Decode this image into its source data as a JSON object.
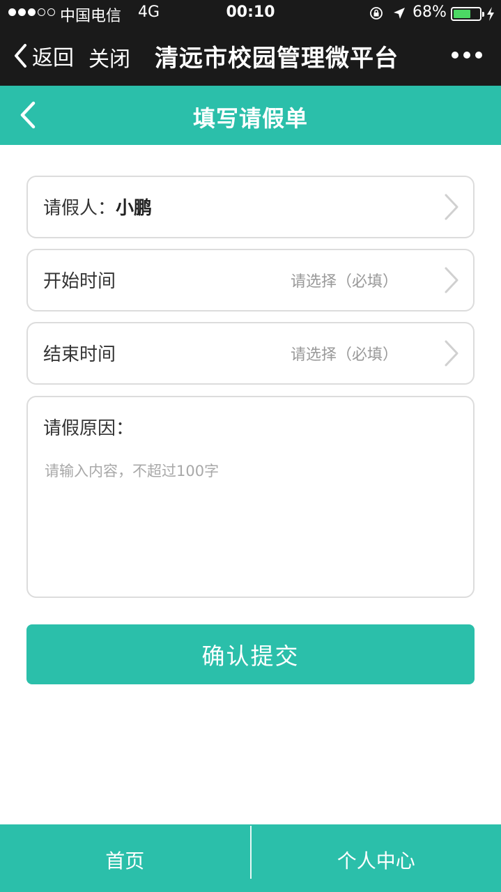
{
  "status_bar": {
    "signal_bars_on": 3,
    "carrier": "中国电信",
    "network": "4G",
    "time": "00:10",
    "battery_percent": "68%",
    "icons": [
      "orientation-lock-icon",
      "location-arrow-icon",
      "battery-icon",
      "charging-bolt-icon"
    ]
  },
  "wechat_nav": {
    "back_label": "返回",
    "close_label": "关闭",
    "title": "清远市校园管理微平台",
    "more_icon": "more-dots-icon"
  },
  "page_header": {
    "back_icon": "chevron-left-icon",
    "title": "填写请假单"
  },
  "form": {
    "applicant": {
      "label": "请假人：",
      "value": "小鹏"
    },
    "start_time": {
      "label": "开始时间",
      "placeholder": "请选择（必填）"
    },
    "end_time": {
      "label": "结束时间",
      "placeholder": "请选择（必填）"
    },
    "reason": {
      "label": "请假原因：",
      "placeholder": "请输入内容，不超过100字"
    },
    "submit_label": "确认提交"
  },
  "tab_bar": {
    "items": [
      {
        "label": "首页"
      },
      {
        "label": "个人中心"
      }
    ]
  },
  "colors": {
    "accent": "#2bbfaa",
    "top_bar": "#1a1a1a",
    "battery_fill": "#4cd964",
    "border": "#dcdcdc",
    "placeholder": "#999999"
  }
}
